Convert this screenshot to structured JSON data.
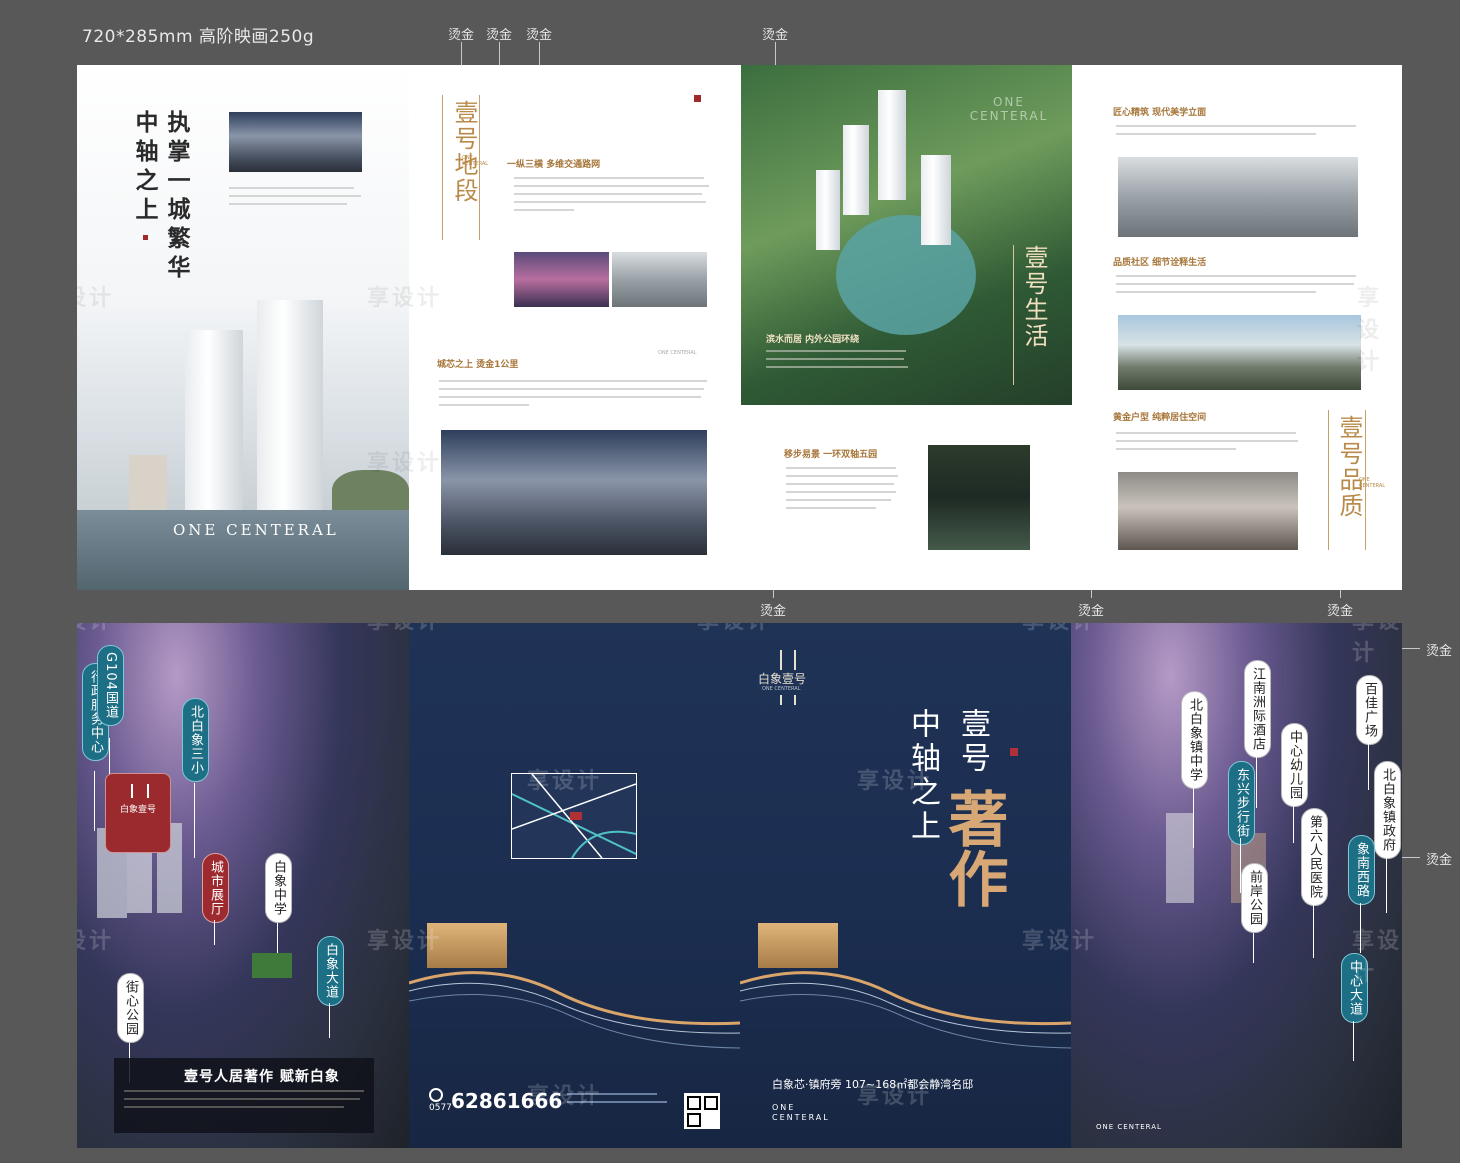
{
  "spec": "720*285mm 高阶映画250g",
  "annotation": "烫金",
  "p1": {
    "title_a": "执掌一城繁华",
    "title_b": "中轴之上",
    "brand": "ONE CENTERAL"
  },
  "p2": {
    "vtitle": "壹号地段",
    "en": "ONE CENTERAL",
    "sec1": "一纵三横 多维交通路网",
    "sec2": "城芯之上 烫金1公里",
    "mini_en": "ONE CENTERAL"
  },
  "p3": {
    "en": "ONE CENTERAL",
    "vtitle": "壹号生活",
    "sec1": "滨水而居 内外公园环绕",
    "sec2": "移步易景 一环双轴五园"
  },
  "p4": {
    "sec1": "匠心精筑 现代美学立面",
    "sec2": "品质社区 细节诠释生活",
    "sec3": "黄金户型 纯粹居住空间",
    "vtitle": "壹号品质",
    "en": "ONE CENTERAL"
  },
  "watermark": "享设计",
  "bottom_left": {
    "tags": {
      "admin": "行政服务中心",
      "g104": "G104国道",
      "school3": "北白象三小",
      "exhibit": "城市展厅",
      "mid": "白象中学",
      "road": "白象大道",
      "park": "街心公园"
    },
    "logo": "白象壹号",
    "slogan": "壹号人居著作 赋新白象"
  },
  "back_cover": {
    "phone_prefix": "0577",
    "phone": "62861666"
  },
  "front_cover": {
    "logo": "白象壹号",
    "logo_en": "ONE CENTERAL",
    "title_a": "壹号",
    "title_b": "中轴之上",
    "title_big": "著作",
    "subtitle": "白象芯·镇府旁 107~168㎡都会静湾名邸",
    "brand_line1": "ONE",
    "brand_line2": "CENTERAL"
  },
  "bottom_right": {
    "tags": {
      "school": "北白象镇中学",
      "hotel": "江南洲际酒店",
      "walk": "东兴步行街",
      "kinder": "中心幼儿园",
      "plaza": "百佳广场",
      "gov": "北白象镇政府",
      "hospital": "第六人民医院",
      "xiangnan": "象南西路",
      "qianan": "前岸公园",
      "center": "中心大道"
    },
    "brand": "ONE CENTERAL"
  }
}
